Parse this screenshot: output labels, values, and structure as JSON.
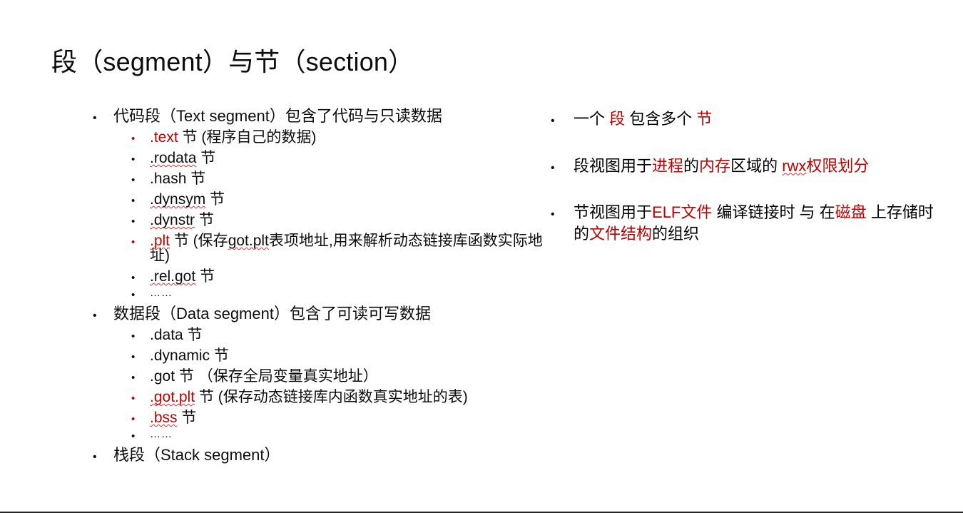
{
  "slide": {
    "title": "段（segment）与节（section）",
    "accent_red": "#C00000",
    "text_color": "#0D0D0D",
    "background": "#FFFFFF",
    "spellcheck_underline_color": "#E03030"
  },
  "left_column": {
    "items": [
      {
        "level": 1,
        "bullet": "•",
        "bullet_color": "black",
        "runs": [
          {
            "text": "代码段（Text segment）包含了代码与只读数据",
            "color": "black",
            "spellcheck": false
          }
        ]
      },
      {
        "level": 2,
        "bullet": "•",
        "bullet_color": "red",
        "runs": [
          {
            "text": ".text",
            "color": "red",
            "spellcheck": false
          },
          {
            "text": " 节 (程序自己的数据)",
            "color": "black",
            "spellcheck": false
          }
        ]
      },
      {
        "level": 2,
        "bullet": "•",
        "bullet_color": "black",
        "runs": [
          {
            "text": ".rodata",
            "color": "black",
            "spellcheck": true
          },
          {
            "text": " 节",
            "color": "black",
            "spellcheck": false
          }
        ]
      },
      {
        "level": 2,
        "bullet": "•",
        "bullet_color": "black",
        "runs": [
          {
            "text": ".hash",
            "color": "black",
            "spellcheck": false
          },
          {
            "text": " 节",
            "color": "black",
            "spellcheck": false
          }
        ]
      },
      {
        "level": 2,
        "bullet": "•",
        "bullet_color": "black",
        "runs": [
          {
            "text": ".dynsym",
            "color": "black",
            "spellcheck": true
          },
          {
            "text": " 节",
            "color": "black",
            "spellcheck": false
          }
        ]
      },
      {
        "level": 2,
        "bullet": "•",
        "bullet_color": "black",
        "runs": [
          {
            "text": ".dynstr",
            "color": "black",
            "spellcheck": true
          },
          {
            "text": " 节",
            "color": "black",
            "spellcheck": false
          }
        ]
      },
      {
        "level": 2,
        "bullet": "•",
        "bullet_color": "red",
        "runs": [
          {
            "text": ".plt",
            "color": "red",
            "spellcheck": true
          },
          {
            "text": " 节 (保存",
            "color": "black",
            "spellcheck": false
          },
          {
            "text": "got.plt",
            "color": "black",
            "spellcheck": true
          },
          {
            "text": "表项地址,用来解析动态链接库函数实际地址)",
            "color": "black",
            "spellcheck": false
          }
        ]
      },
      {
        "level": 2,
        "bullet": "•",
        "bullet_color": "black",
        "runs": [
          {
            "text": ".rel.got",
            "color": "black",
            "spellcheck": true
          },
          {
            "text": " 节",
            "color": "black",
            "spellcheck": false
          }
        ]
      },
      {
        "level": 2,
        "bullet": "•",
        "bullet_color": "black",
        "ellipsis": true,
        "runs": [
          {
            "text": "……",
            "color": "black",
            "spellcheck": false
          }
        ]
      },
      {
        "level": 1,
        "bullet": "•",
        "bullet_color": "black",
        "runs": [
          {
            "text": "数据段（Data segment）包含了可读可写数据",
            "color": "black",
            "spellcheck": false
          }
        ]
      },
      {
        "level": 2,
        "bullet": "•",
        "bullet_color": "black",
        "runs": [
          {
            "text": ".data 节",
            "color": "black",
            "spellcheck": false
          }
        ]
      },
      {
        "level": 2,
        "bullet": "•",
        "bullet_color": "black",
        "runs": [
          {
            "text": ".dynamic 节",
            "color": "black",
            "spellcheck": false
          }
        ]
      },
      {
        "level": 2,
        "bullet": "•",
        "bullet_color": "black",
        "runs": [
          {
            "text": ".got 节 （保存全局变量真实地址）",
            "color": "black",
            "spellcheck": false
          }
        ]
      },
      {
        "level": 2,
        "bullet": "•",
        "bullet_color": "red",
        "runs": [
          {
            "text": ".got.plt",
            "color": "red",
            "spellcheck": true
          },
          {
            "text": " 节 (保存动态链接库内函数真实地址的表)",
            "color": "black",
            "spellcheck": false
          }
        ]
      },
      {
        "level": 2,
        "bullet": "•",
        "bullet_color": "red",
        "runs": [
          {
            "text": ".bss",
            "color": "red",
            "spellcheck": true
          },
          {
            "text": " 节",
            "color": "black",
            "spellcheck": false
          }
        ]
      },
      {
        "level": 2,
        "bullet": "•",
        "bullet_color": "black",
        "ellipsis": true,
        "runs": [
          {
            "text": "……",
            "color": "black",
            "spellcheck": false
          }
        ]
      },
      {
        "level": 1,
        "bullet": "•",
        "bullet_color": "black",
        "runs": [
          {
            "text": "栈段（Stack segment）",
            "color": "black",
            "spellcheck": false
          }
        ]
      }
    ]
  },
  "right_column": {
    "items": [
      {
        "bullet": "•",
        "runs": [
          {
            "text": "一个 ",
            "color": "black",
            "spellcheck": false
          },
          {
            "text": "段",
            "color": "red",
            "spellcheck": false
          },
          {
            "text": " 包含多个 ",
            "color": "black",
            "spellcheck": false
          },
          {
            "text": "节",
            "color": "red",
            "spellcheck": false
          }
        ]
      },
      {
        "bullet": "•",
        "runs": [
          {
            "text": "段视图用于",
            "color": "black",
            "spellcheck": false
          },
          {
            "text": "进程",
            "color": "red",
            "spellcheck": false
          },
          {
            "text": "的",
            "color": "black",
            "spellcheck": false
          },
          {
            "text": "内存",
            "color": "red",
            "spellcheck": false
          },
          {
            "text": "区域的 ",
            "color": "black",
            "spellcheck": false
          },
          {
            "text": "rwx",
            "color": "red",
            "spellcheck": true
          },
          {
            "text": "权限划分",
            "color": "red",
            "spellcheck": false
          }
        ]
      },
      {
        "bullet": "•",
        "runs": [
          {
            "text": "节视图用于",
            "color": "black",
            "spellcheck": false
          },
          {
            "text": "ELF文件",
            "color": "red",
            "spellcheck": false
          },
          {
            "text": " 编译链接时 与 在",
            "color": "black",
            "spellcheck": false
          },
          {
            "text": "磁盘",
            "color": "red",
            "spellcheck": false
          },
          {
            "text": "\n上存储时 的",
            "color": "black",
            "spellcheck": false
          },
          {
            "text": "文件结构",
            "color": "red",
            "spellcheck": false
          },
          {
            "text": "的组织",
            "color": "black",
            "spellcheck": false
          }
        ]
      }
    ]
  }
}
